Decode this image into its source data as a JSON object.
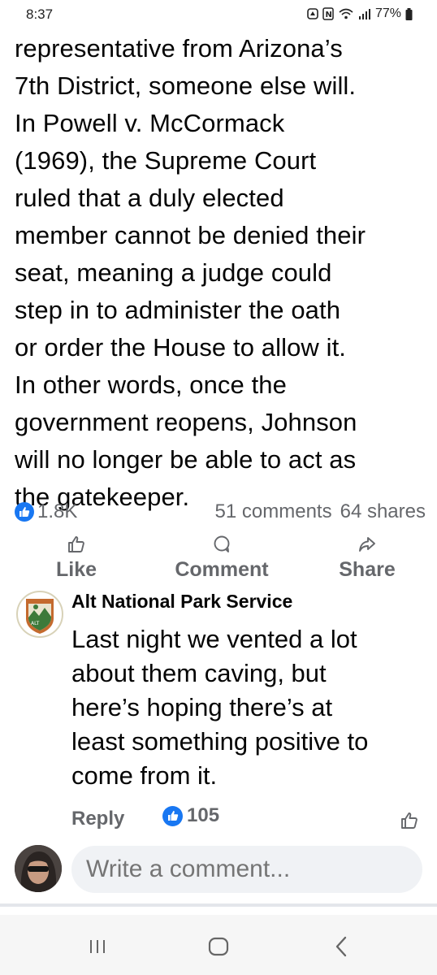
{
  "status_bar": {
    "time": "8:37",
    "battery": "77%"
  },
  "post": {
    "text": "representative from Arizona’s\n7th District, someone else will.\nIn Powell v. McCormack\n(1969), the Supreme Court\nruled that a duly elected\nmember cannot be denied their\nseat, meaning a judge could\nstep in to administer the oath\nor order the House to allow it.\nIn other words, once the\ngovernment reopens, Johnson\nwill no longer be able to act as\nthe gatekeeper."
  },
  "stats": {
    "reactions": "1.8K",
    "comments": "51 comments",
    "shares": "64 shares"
  },
  "actions": {
    "like": "Like",
    "comment": "Comment",
    "share": "Share"
  },
  "comment": {
    "author": "Alt National Park Service",
    "text": "Last night we vented a lot\nabout them caving, but\nhere’s hoping there’s at\nleast something positive to\ncome from it.",
    "reply_label": "Reply",
    "reaction_count": "105",
    "avatar_text": "ALT"
  },
  "composer": {
    "placeholder": "Write a comment..."
  },
  "colors": {
    "brand_blue": "#1877f2",
    "secondary_text": "#65676b"
  }
}
